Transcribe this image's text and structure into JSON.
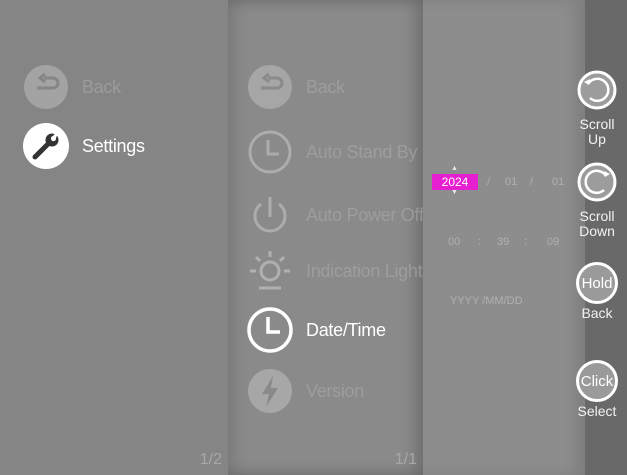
{
  "panel1": {
    "items": [
      {
        "label": "Back",
        "icon": "back-arrow-icon"
      },
      {
        "label": "Settings",
        "icon": "wrench-icon"
      }
    ],
    "page": "1/2"
  },
  "panel2": {
    "items": [
      {
        "label": "Back",
        "icon": "back-arrow-icon"
      },
      {
        "label": "Auto Stand By",
        "icon": "clock-icon"
      },
      {
        "label": "Auto Power Off",
        "icon": "power-icon"
      },
      {
        "label": "Indication Light",
        "icon": "light-icon"
      },
      {
        "label": "Date/Time",
        "icon": "clock-icon"
      },
      {
        "label": "Version",
        "icon": "lightning-icon"
      }
    ],
    "page": "1/1"
  },
  "datetime": {
    "year": "2024",
    "month": "01",
    "day": "01",
    "date_sep": "/",
    "hour": "00",
    "minute": "39",
    "second": "09",
    "time_sep": ":",
    "format": "YYYY /MM/DD"
  },
  "controls": [
    {
      "circle_text": "",
      "label": "Scroll\nUp",
      "icon": "scroll-up-icon"
    },
    {
      "circle_text": "",
      "label": "Scroll\nDown",
      "icon": "scroll-down-icon"
    },
    {
      "circle_text": "Hold",
      "label": "Back",
      "icon": "hold-button-icon"
    },
    {
      "circle_text": "Click",
      "label": "Select",
      "icon": "click-button-icon"
    }
  ],
  "colors": {
    "highlight": "#e61fd0",
    "sidebar": "#6a6969"
  }
}
